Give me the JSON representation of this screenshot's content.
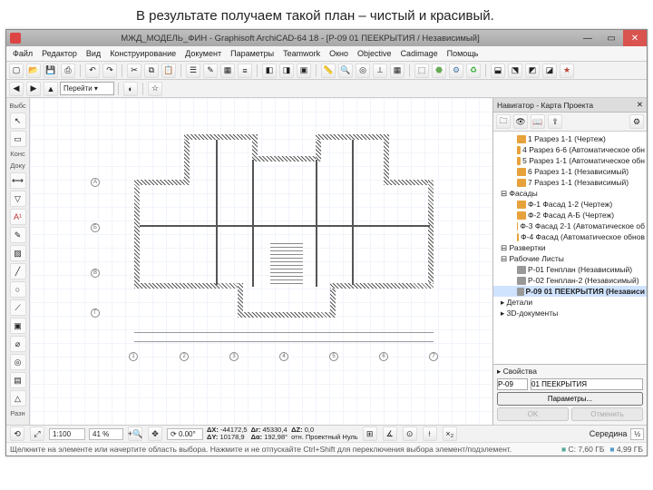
{
  "caption": "В результате получаем такой план – чистый и красивый.",
  "titlebar": {
    "title": "МЖД_МОДЕЛЬ_ФИН - Graphisoft ArchiCAD-64 18 - [P-09 01 ПЕЕКРЫТИЯ / Независимый]"
  },
  "menu": [
    "Файл",
    "Редактор",
    "Вид",
    "Конструирование",
    "Документ",
    "Параметры",
    "Teamwork",
    "Окно",
    "Objective",
    "Cadimage",
    "Помощь"
  ],
  "toolbar2": {
    "goto_label": "Перейти ▾"
  },
  "toolbox": {
    "tab1": "Выбс",
    "tab2": "Конс",
    "tab3": "Доку",
    "tab4": "Разн"
  },
  "navigator": {
    "title": "Навигатор - Карта Проекта",
    "tree": [
      {
        "t": "item",
        "l": 2,
        "ico": "o",
        "label": "1 Разрез 1-1 (Чертеж)"
      },
      {
        "t": "item",
        "l": 2,
        "ico": "o",
        "label": "4 Разрез 6-6 (Автоматическое обн"
      },
      {
        "t": "item",
        "l": 2,
        "ico": "o",
        "label": "5 Разрез 1-1 (Автоматическое обн"
      },
      {
        "t": "item",
        "l": 2,
        "ico": "o",
        "label": "6 Разрез 1-1 (Независимый)"
      },
      {
        "t": "item",
        "l": 2,
        "ico": "o",
        "label": "7 Разрез 1-1 (Независимый)"
      },
      {
        "t": "cat",
        "label": "⊟ Фасады"
      },
      {
        "t": "item",
        "l": 2,
        "ico": "o",
        "label": "Ф-1 Фасад 1-2 (Чертеж)"
      },
      {
        "t": "item",
        "l": 2,
        "ico": "o",
        "label": "Ф-2 Фасад А-Б (Чертеж)"
      },
      {
        "t": "item",
        "l": 2,
        "ico": "o",
        "label": "Ф-3 Фасад 2-1 (Автоматическое об"
      },
      {
        "t": "item",
        "l": 2,
        "ico": "o",
        "label": "Ф-4 Фасад (Автоматическое обнов"
      },
      {
        "t": "cat",
        "label": "⊟ Развертки"
      },
      {
        "t": "cat",
        "label": "⊟ Рабочие Листы"
      },
      {
        "t": "item",
        "l": 2,
        "ico": "g",
        "label": "P-01 Генплан (Независимый)"
      },
      {
        "t": "item",
        "l": 2,
        "ico": "g",
        "label": "P-02 Генплан-2 (Независимый)"
      },
      {
        "t": "item",
        "l": 2,
        "ico": "g",
        "sel": true,
        "label": "P-09 01 ПЕЕКРЫТИЯ (Независи"
      },
      {
        "t": "cat",
        "label": "▸ Детали"
      },
      {
        "t": "cat",
        "label": "▸ 3D-документы"
      }
    ],
    "prop_title": "▸ Свойства",
    "id": "P-09",
    "name": "01 ПЕЕКРЫТИЯ",
    "params_btn": "Параметры...",
    "ok": "OK",
    "cancel": "Отменить"
  },
  "status": {
    "scale": "1:100",
    "zoom": "41 %",
    "angle": "0.00°",
    "dx_label": "ΔX:",
    "dx": "-44172,5",
    "dy_label": "ΔY:",
    "dy": "10178,9",
    "dr_label": "Δr:",
    "dr": "45330,4",
    "da_label": "Δα:",
    "da": "192,98°",
    "dz_label": "ΔZ:",
    "dz": "0,0",
    "dz_ref": "отн. Проектный Нуль",
    "mid": "Середина",
    "s": "½"
  },
  "hint": "Щелкните на элементе или начертите область выбора. Нажмите и не отпускайте Ctrl+Shift для переключения выбора элемент/подэлемент.",
  "mem": {
    "c": "C: 7,60 ГБ",
    "d": "4,99 ГБ"
  },
  "plan": {
    "axes_h": [
      "А",
      "Б",
      "В",
      "Г"
    ],
    "axes_v": [
      "1",
      "2",
      "3",
      "4",
      "5",
      "6",
      "7"
    ]
  }
}
